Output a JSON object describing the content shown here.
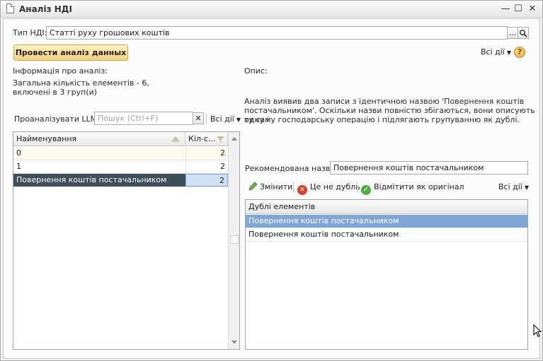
{
  "window": {
    "title": "Аналіз НДІ",
    "controls": {
      "minimize": "—",
      "maximize": "☐",
      "close": "✕"
    }
  },
  "type_field": {
    "label": "Тип НДІ:",
    "value": "Статті руху грошових коштів",
    "select_label": "...",
    "open_label": "🔍"
  },
  "analyze_button": {
    "label": "Провести аналіз данных"
  },
  "top_all_actions": {
    "label": "Всі дії"
  },
  "help": {
    "label": "?"
  },
  "analysis_info": {
    "label": "Інформація про аналіз:",
    "text_line1": "Загальна кількість елементів - 6,",
    "text_line2": "включені в 3 груп(и)"
  },
  "description": {
    "label": "Опис:",
    "line1": "Аналіз виявив два записи з ідентичною назвою 'Повернення коштів",
    "line2": "постачальником'. Оскільки назви повністю збігаються, вони описують одну і",
    "line3": "ту саму господарську операцію і підлягають групуванню як дублі."
  },
  "left_toolbar": {
    "llm_label": "Проаналізувати LLM",
    "search_placeholder": "Пошук (Ctrl+F)",
    "clear_label": "✕",
    "all_actions": "Всі дії"
  },
  "groups_table": {
    "columns": [
      "Найменування",
      "Кіл-с..."
    ],
    "rows": [
      {
        "name": "0",
        "count": "2"
      },
      {
        "name": "1",
        "count": "2"
      },
      {
        "name": "Повернення коштів постачальником",
        "count": "2"
      }
    ]
  },
  "recommended": {
    "label": "Рекомендована назва:",
    "value": "Повернення коштів постачальником"
  },
  "right_toolbar": {
    "edit": "Змінити",
    "not_duplicate": "Це не дубль",
    "mark_original": "Відмітити як оригінал",
    "all_actions": "Всі дії"
  },
  "duplicates_table": {
    "header": "Дублі елементів",
    "rows": [
      "Повернення коштів постачальником",
      "Повернення коштів постачальником"
    ]
  },
  "colors": {
    "selected_dark": "#3d4f58",
    "selected_blue": "#7fa6d6",
    "highlight_row": "#fdf9ec",
    "button_yellow": "#f3d27e"
  }
}
